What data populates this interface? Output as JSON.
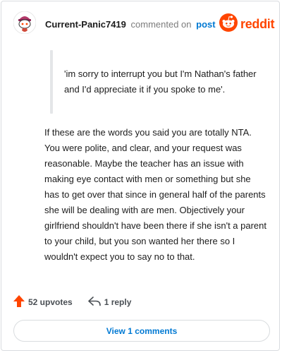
{
  "comment": {
    "author": "Current-Panic7419",
    "commented_text": "commented on",
    "post_link": "post",
    "brand": "reddit",
    "quote": "'im sorry to interrupt you but I'm Nathan's father and I'd appreciate it if you spoke to me'.",
    "body": "If these are the words you said you are totally NTA. You were polite, and clear, and your request was reasonable. Maybe the teacher has an issue with making eye contact with men or something but she has to get over that since in general half of the parents she will be dealing with are men. Objectively your girlfriend shouldn't have been there if she isn't a parent to your child, but you son wanted her there so I wouldn't expect you to say no to that."
  },
  "actions": {
    "upvotes": "52 upvotes",
    "replies": "1 reply"
  },
  "view_comments": "View 1 comments",
  "icons": {
    "avatar": "snoo-avatar-icon",
    "logo": "reddit-logo-icon",
    "upvote": "upvote-arrow-icon",
    "reply": "reply-arrow-icon"
  },
  "colors": {
    "brand": "#ff4500",
    "link": "#0079d3",
    "muted": "#7c7c7c",
    "quote_bar": "#e4e6e8"
  }
}
